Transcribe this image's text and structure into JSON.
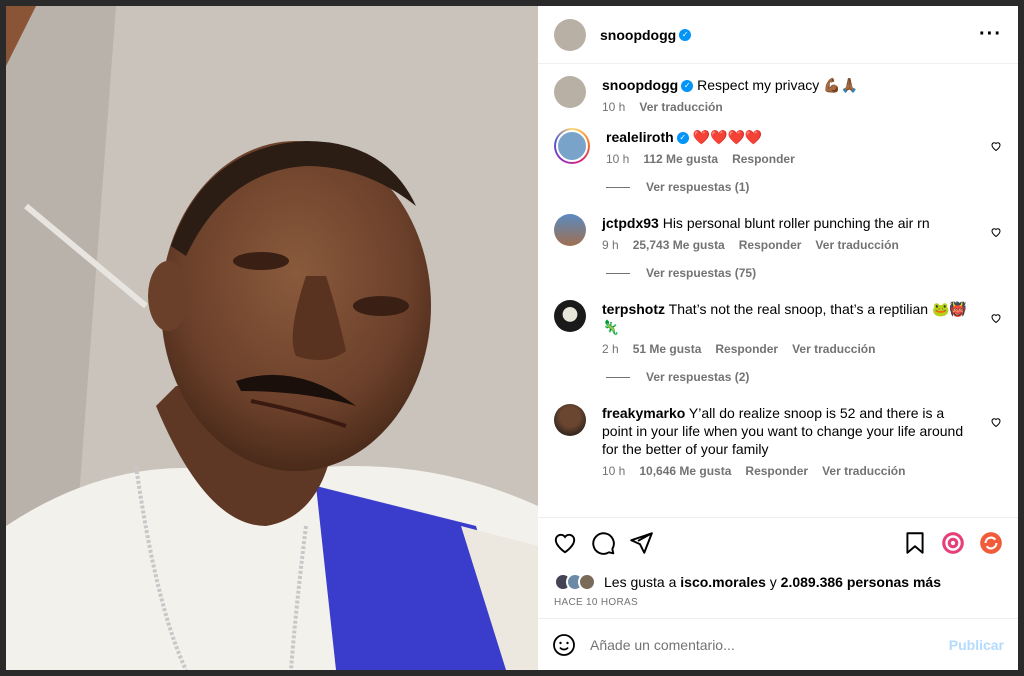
{
  "post": {
    "author": "snoopdogg",
    "caption": "Respect my privacy 💪🏾🙏🏾",
    "caption_time": "10 h",
    "caption_translate": "Ver traducción"
  },
  "comments": [
    {
      "user": "realeliroth",
      "verified": true,
      "text": "❤️❤️❤️❤️",
      "time": "10 h",
      "likes": "112 Me gusta",
      "reply": "Responder",
      "translate": "",
      "replies": "Ver respuestas (1)"
    },
    {
      "user": "jctpdx93",
      "verified": false,
      "text": "His personal blunt roller punching the air rn",
      "time": "9 h",
      "likes": "25,743 Me gusta",
      "reply": "Responder",
      "translate": "Ver traducción",
      "replies": "Ver respuestas (75)"
    },
    {
      "user": "terpshotz",
      "verified": false,
      "text": "That’s not the real snoop, that’s a reptilian 🐸👹🦎",
      "time": "2 h",
      "likes": "51 Me gusta",
      "reply": "Responder",
      "translate": "Ver traducción",
      "replies": "Ver respuestas (2)"
    },
    {
      "user": "freakymarko",
      "verified": false,
      "text": "Y’all do realize snoop is 52 and there is a point in your life when you want to change your life around for the better of your family",
      "time": "10 h",
      "likes": "10,646 Me gusta",
      "reply": "Responder",
      "translate": "Ver traducción",
      "replies": ""
    }
  ],
  "likes_line": {
    "prefix": "Les gusta a",
    "user": "isco.morales",
    "conj": "y",
    "others": "2.089.386 personas más"
  },
  "posted_time": "HACE 10 HORAS",
  "add_comment": {
    "placeholder": "Añade un comentario...",
    "publish": "Publicar"
  },
  "colors": {
    "verified": "#0095f6",
    "muted": "#737373",
    "publish_disabled": "#b3dbff"
  },
  "icons": {
    "like": "heart-icon",
    "comment": "comment-icon",
    "share": "paper-plane-icon",
    "save": "bookmark-icon",
    "emoji": "smiley-icon",
    "more": "ellipsis-icon"
  }
}
